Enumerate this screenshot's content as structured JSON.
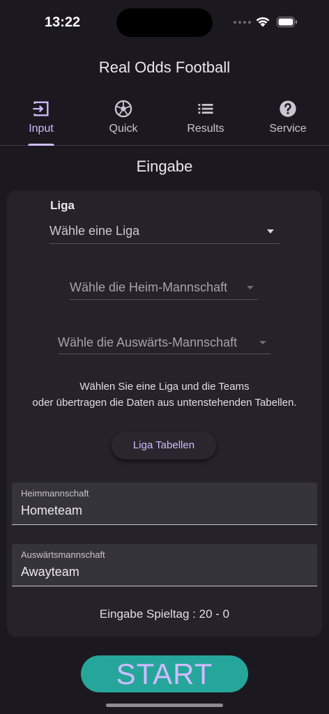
{
  "status": {
    "time": "13:22"
  },
  "app": {
    "title": "Real Odds Football"
  },
  "tabs": [
    {
      "label": "Input",
      "icon": "input-icon",
      "active": true
    },
    {
      "label": "Quick",
      "icon": "soccer-ball-icon",
      "active": false
    },
    {
      "label": "Results",
      "icon": "list-icon",
      "active": false
    },
    {
      "label": "Service",
      "icon": "help-icon",
      "active": false
    }
  ],
  "page": {
    "section_title": "Eingabe"
  },
  "form": {
    "liga_label": "Liga",
    "liga_select": "Wähle eine Liga",
    "home_select": "Wähle die Heim-Mannschaft",
    "away_select": "Wähle die Auswärts-Mannschaft",
    "hint_line1": "Wählen Sie eine Liga und die Teams",
    "hint_line2": "oder übertragen die Daten aus untenstehenden Tabellen.",
    "liga_tables_button": "Liga Tabellen",
    "home_field": {
      "label": "Heimmannschaft",
      "value": "Hometeam"
    },
    "away_field": {
      "label": "Auswärtsmannschaft",
      "value": "Awayteam"
    },
    "matchday": "Eingabe Spieltag : 20 - 0",
    "start_button": "START"
  },
  "colors": {
    "accent": "#cfbcff",
    "start": "#26a69a",
    "background": "#1b191f",
    "card": "#252229"
  }
}
